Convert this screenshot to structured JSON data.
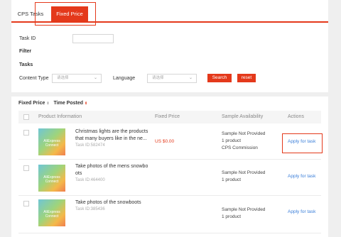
{
  "tabs": {
    "cps": "CPS Tasks",
    "fixed": "Fixed Price"
  },
  "filters": {
    "task_id_label": "Task ID",
    "filter_label": "Filter",
    "tasks_label": "Tasks",
    "content_type_label": "Content Type",
    "content_type_value": "请选择",
    "language_label": "Language",
    "language_value": "请选择",
    "search_label": "Search",
    "reset_label": "reset"
  },
  "sort": {
    "fixed_price": "Fixed Price",
    "time_posted": "Time Posted"
  },
  "table": {
    "headers": {
      "product": "Product Information",
      "price": "Fixed Price",
      "availability": "Sample Availability",
      "actions": "Actions"
    },
    "rows": [
      {
        "thumb_text": "AliExpress Connect",
        "title_l1": "Christmas lights are the products",
        "title_l2": "that many buyers like in the ne...",
        "task_id": "Task ID:582474",
        "price": "US $0.00",
        "avail_l1": "Sample Not Provided",
        "avail_l2": "1 product",
        "avail_l3": "CPS Commission",
        "action": "Apply for task"
      },
      {
        "thumb_text": "AliExpress Connect",
        "title_l1": "Take photos of the mens snowbo",
        "title_l2": "ots",
        "task_id": "Task ID:464400",
        "price": "",
        "avail_l1": "Sample Not Provided",
        "avail_l2": "1 product",
        "avail_l3": "",
        "action": "Apply for task"
      },
      {
        "thumb_text": "AliExpress Connect",
        "title_l1": "Take photos of the snowboots",
        "title_l2": "",
        "task_id": "Task ID:385436",
        "price": "",
        "avail_l1": "Sample Not Provided",
        "avail_l2": "1 product",
        "avail_l3": "",
        "action": "Apply for task"
      }
    ]
  },
  "colors": {
    "accent": "#e4391b",
    "link": "#3b7fd9"
  }
}
